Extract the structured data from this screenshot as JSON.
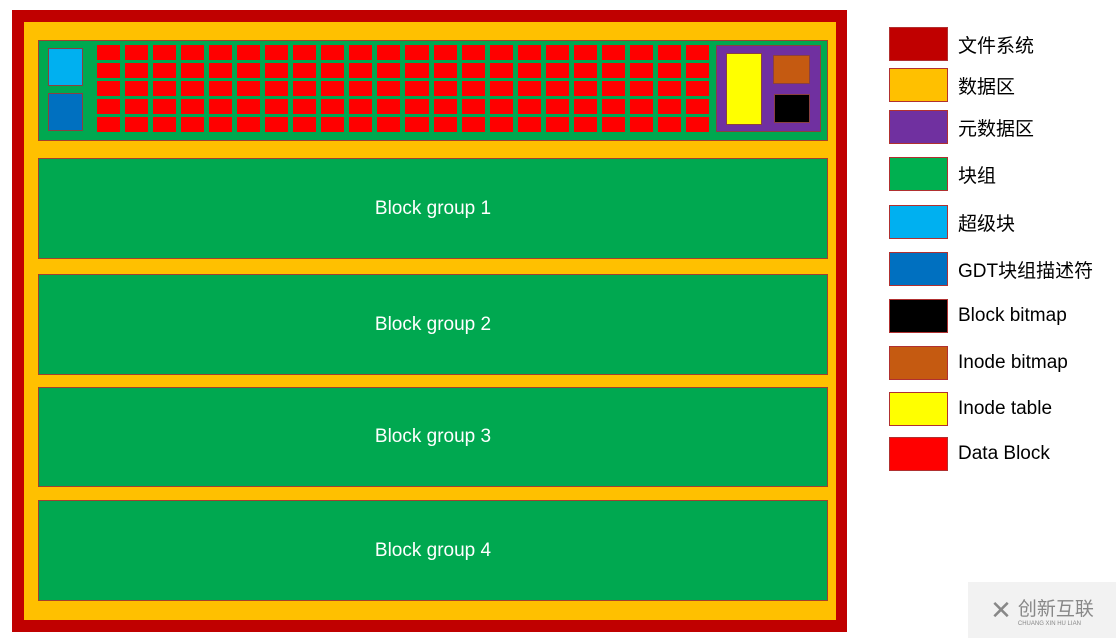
{
  "diagram": {
    "block_groups": [
      {
        "label": "Block group 1"
      },
      {
        "label": "Block group 2"
      },
      {
        "label": "Block group 3"
      },
      {
        "label": "Block group 4"
      }
    ],
    "data_block_grid": {
      "columns": 22,
      "rows": 5
    }
  },
  "legend": [
    {
      "label": "文件系统",
      "color": "#c00000"
    },
    {
      "label": "数据区",
      "color": "#ffc000"
    },
    {
      "label": "元数据区",
      "color": "#7030a0"
    },
    {
      "label": "块组",
      "color": "#00b050"
    },
    {
      "label": "超级块",
      "color": "#00b0f0"
    },
    {
      "label": "GDT块组描述符",
      "color": "#0070c0"
    },
    {
      "label": "Block bitmap",
      "color": "#000000"
    },
    {
      "label": "Inode bitmap",
      "color": "#c55a11"
    },
    {
      "label": "Inode table",
      "color": "#ffff00"
    },
    {
      "label": "Data Block",
      "color": "#ff0000"
    }
  ],
  "watermark": {
    "name": "创新互联",
    "sub": "CHUANG XIN HU LIAN"
  }
}
